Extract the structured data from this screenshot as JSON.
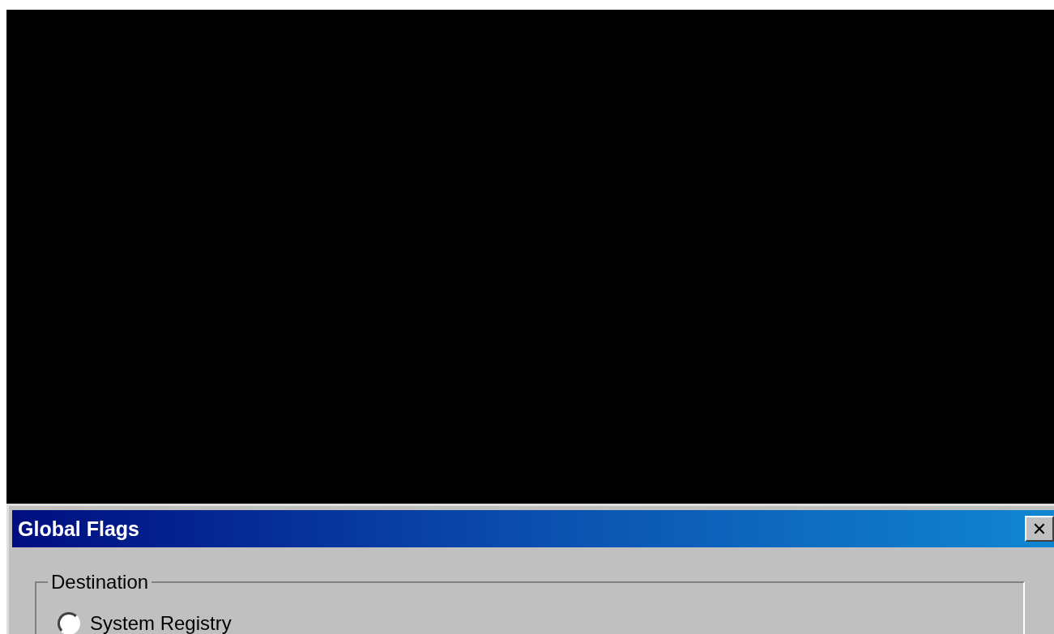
{
  "window": {
    "title": "Global Flags",
    "close_button": "✕"
  },
  "destination": {
    "label": "Destination",
    "options": [
      {
        "label": "System Registry",
        "selected": false
      }
    ]
  }
}
